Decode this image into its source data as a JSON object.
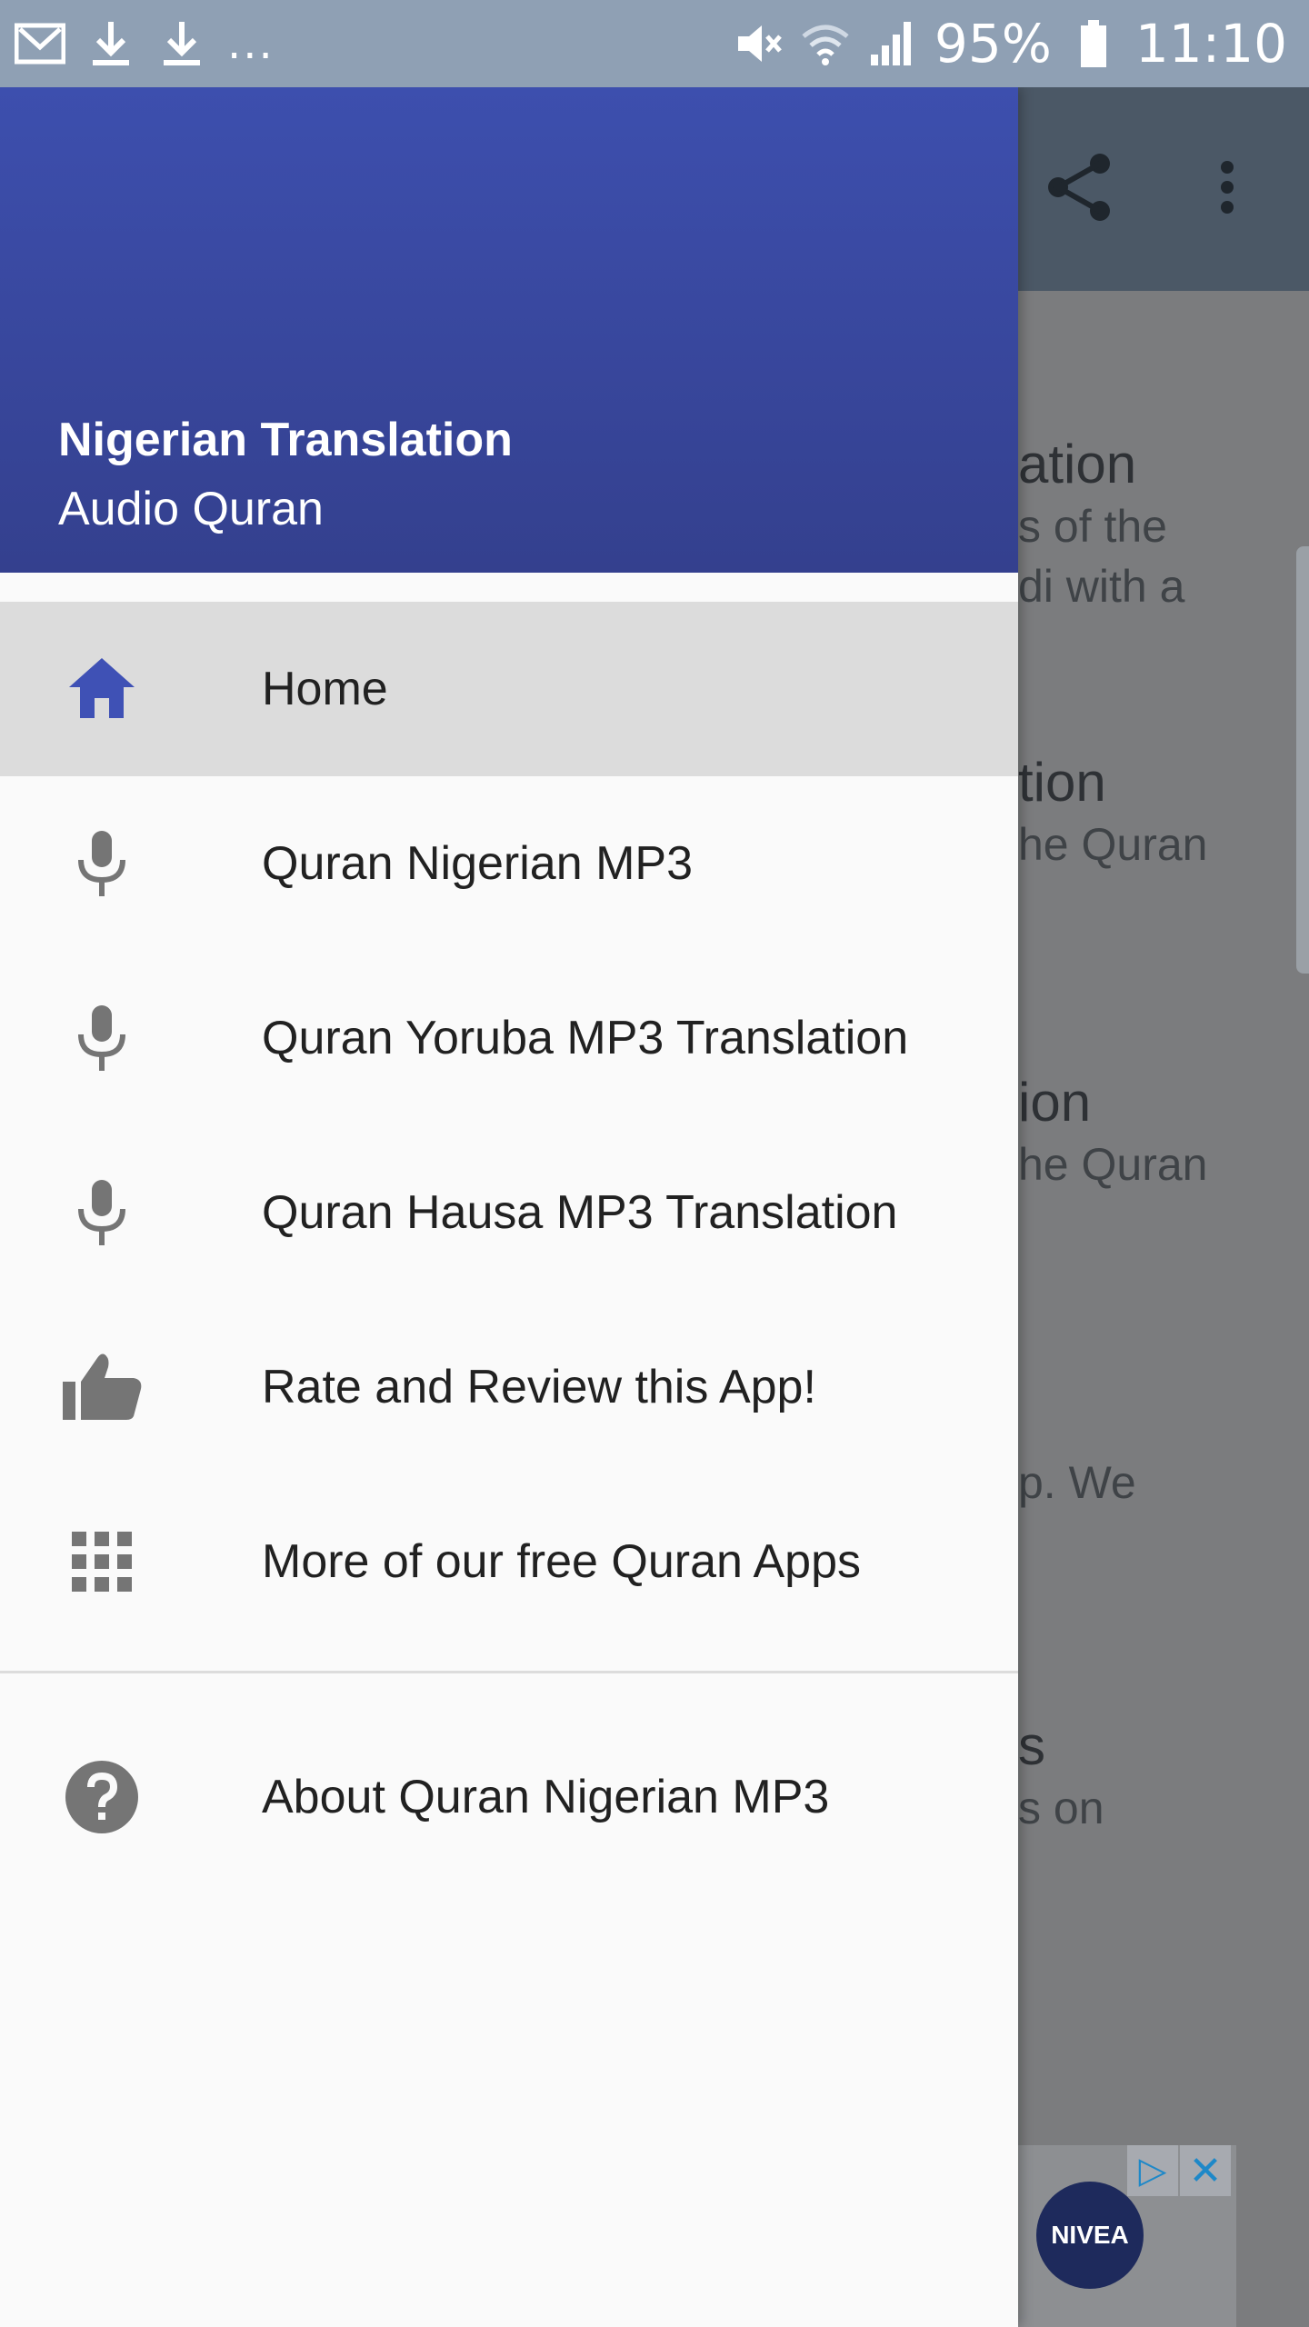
{
  "status_bar": {
    "battery": "95%",
    "time": "11:10",
    "overflow": "..."
  },
  "background_app": {
    "items": [
      {
        "title": "ation",
        "sub1": "s of the",
        "sub2": "di with a"
      },
      {
        "title": "tion",
        "sub1": "he Quran",
        "sub2": ""
      },
      {
        "title": "ion",
        "sub1": "he Quran",
        "sub2": ""
      },
      {
        "title": "",
        "sub1": "p. We",
        "sub2": ""
      },
      {
        "title": "s",
        "sub1": "s on",
        "sub2": ""
      }
    ]
  },
  "ad": {
    "logo_text": "NIVEA"
  },
  "drawer": {
    "title": "Nigerian Translation",
    "subtitle": "Audio Quran",
    "menu": [
      {
        "label": "Home",
        "icon": "home-icon"
      },
      {
        "label": "Quran Nigerian MP3",
        "icon": "microphone-icon"
      },
      {
        "label": "Quran Yoruba MP3 Translation",
        "icon": "microphone-icon"
      },
      {
        "label": "Quran Hausa MP3 Translation",
        "icon": "microphone-icon"
      },
      {
        "label": "Rate and Review this App!",
        "icon": "thumbs-up-icon"
      },
      {
        "label": "More of our free Quran Apps",
        "icon": "apps-grid-icon"
      }
    ],
    "about": {
      "label": "About Quran Nigerian MP3",
      "icon": "help-icon"
    }
  },
  "colors": {
    "header_top": "#3d4fae",
    "header_bottom": "#34408e",
    "home_icon": "#3f51b5",
    "icon_gray": "#757575",
    "selected_bg": "#dcdcdc"
  }
}
